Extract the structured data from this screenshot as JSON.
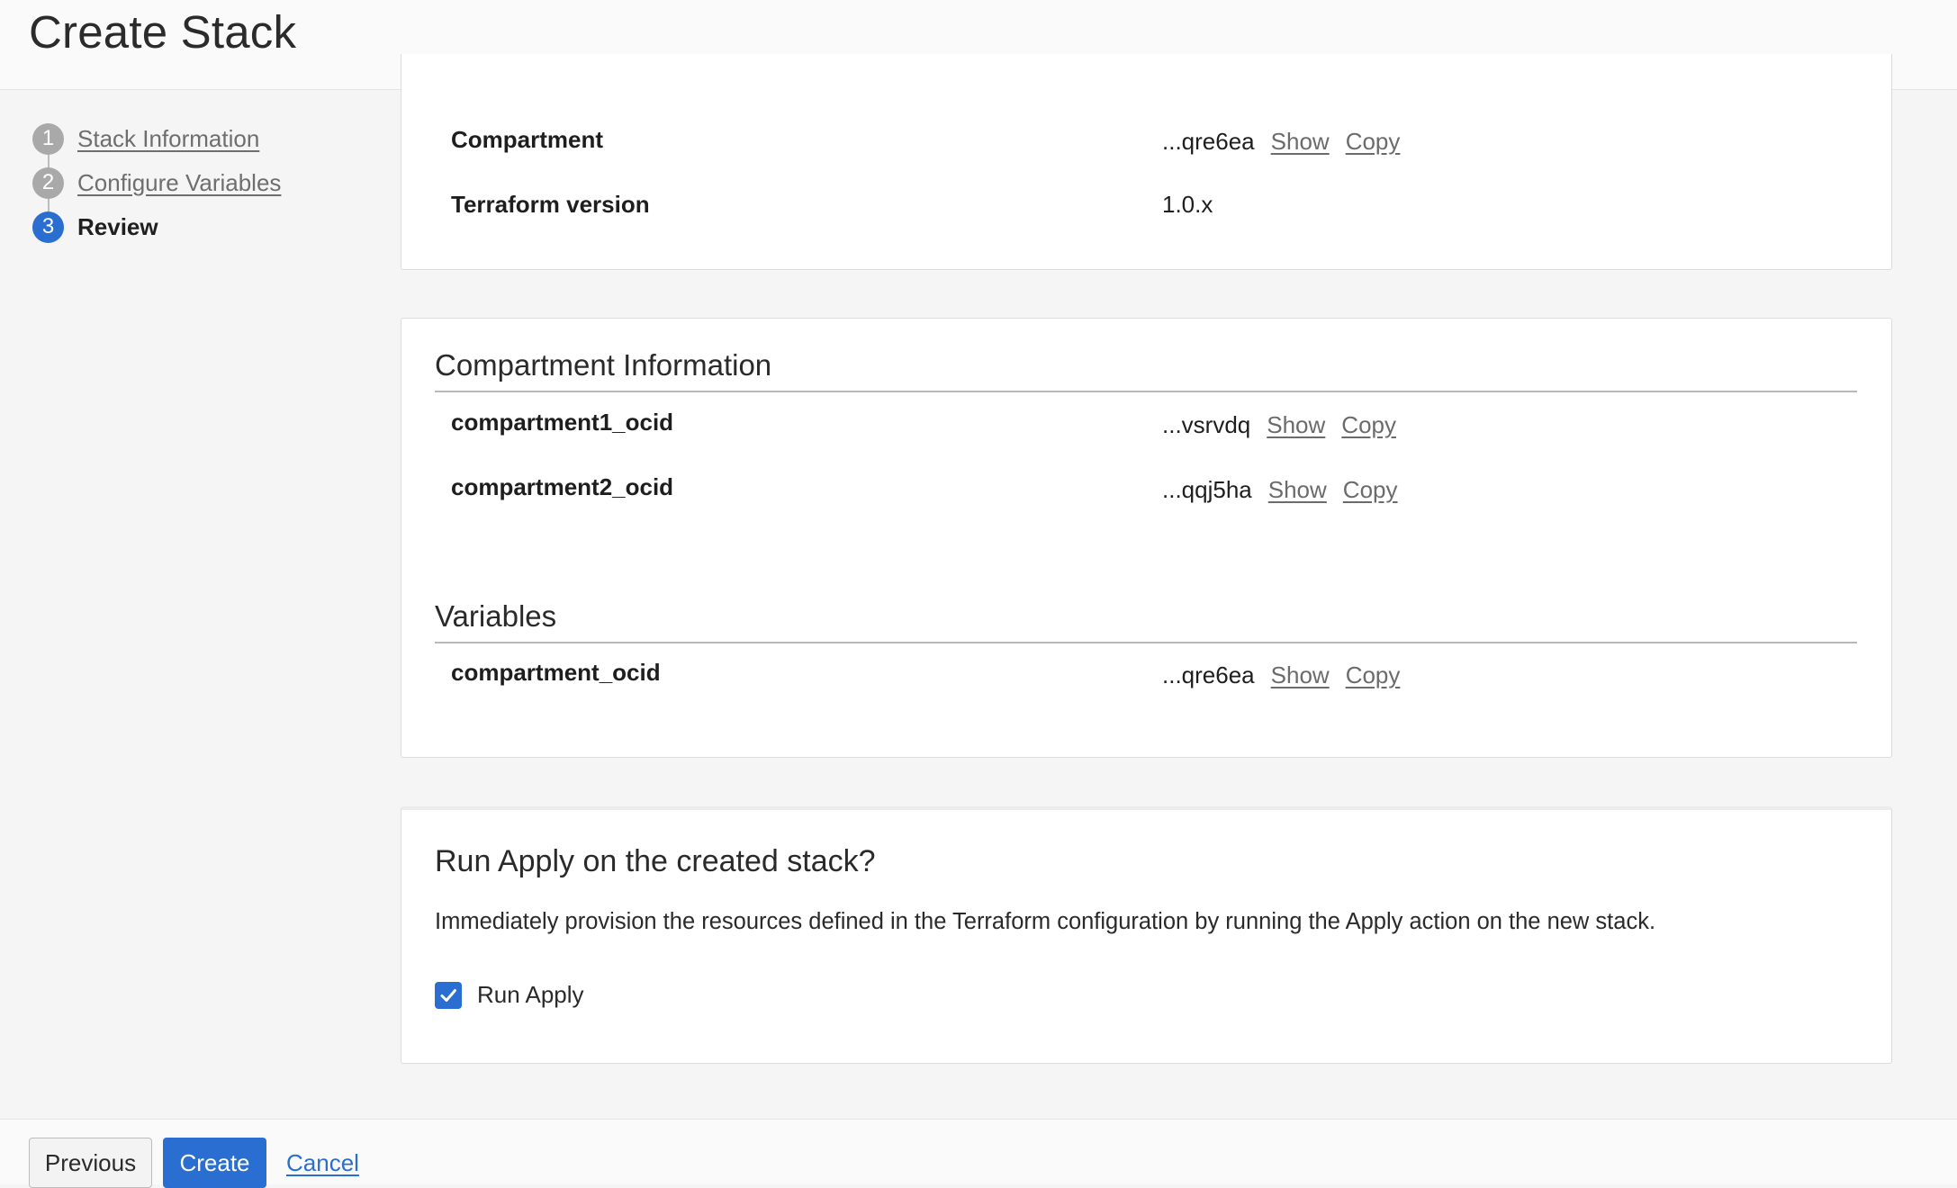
{
  "header": {
    "title": "Create Stack"
  },
  "steps": [
    {
      "number": "1",
      "label": "Stack Information",
      "state": "done"
    },
    {
      "number": "2",
      "label": "Configure Variables",
      "state": "done"
    },
    {
      "number": "3",
      "label": "Review",
      "state": "active"
    }
  ],
  "stack_info": {
    "rows": [
      {
        "label": "Compartment",
        "value": "...qre6ea",
        "show": "Show",
        "copy": "Copy"
      },
      {
        "label": "Terraform version",
        "value": "1.0.x"
      }
    ]
  },
  "compartment_info": {
    "title": "Compartment Information",
    "rows": [
      {
        "label": "compartment1_ocid",
        "value": "...vsrvdq",
        "show": "Show",
        "copy": "Copy"
      },
      {
        "label": "compartment2_ocid",
        "value": "...qqj5ha",
        "show": "Show",
        "copy": "Copy"
      }
    ]
  },
  "variables": {
    "title": "Variables",
    "rows": [
      {
        "label": "compartment_ocid",
        "value": "...qre6ea",
        "show": "Show",
        "copy": "Copy"
      }
    ]
  },
  "run_apply": {
    "title": "Run Apply on the created stack?",
    "description": "Immediately provision the resources defined in the Terraform configuration by running the Apply action on the new stack.",
    "checkbox_label": "Run Apply",
    "checked": true
  },
  "footer": {
    "previous_label": "Previous",
    "create_label": "Create",
    "cancel_label": "Cancel"
  },
  "colors": {
    "accent": "#2b6ed1",
    "step_inactive": "#a9a9a9"
  }
}
